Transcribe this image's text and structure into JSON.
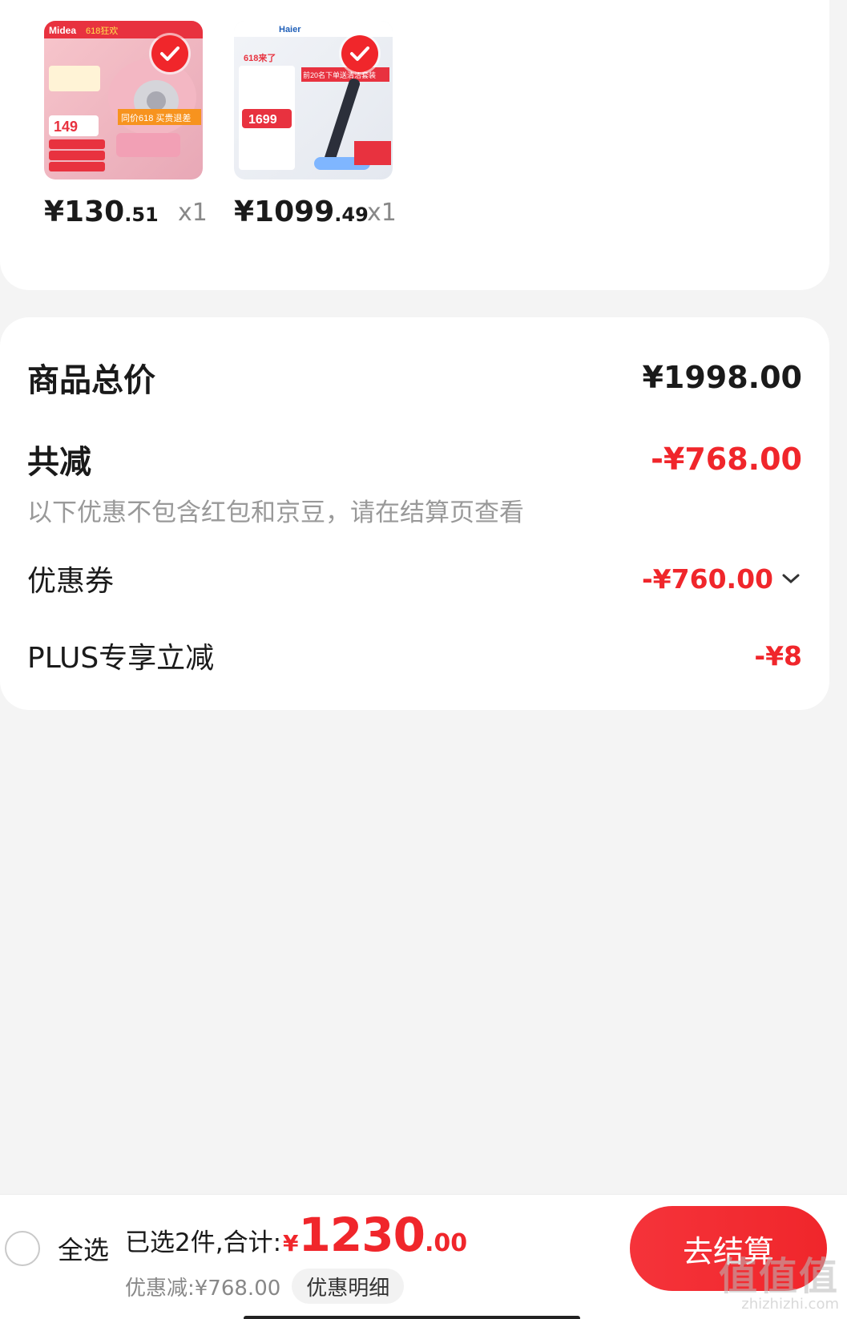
{
  "products": [
    {
      "price_int": "¥130",
      "price_dec": ".51",
      "qty": "x1",
      "brand": "Midea",
      "promo": "618狂欢",
      "badge_price": "149",
      "image_text": "同价618 买贵退差",
      "icon": "check-icon"
    },
    {
      "price_int": "¥1099",
      "price_dec": ".49",
      "qty": "x1",
      "brand": "Haier",
      "promo": "618来了",
      "badge_price": "1699",
      "image_text": "前20名下单送清洁套装",
      "icon": "check-icon"
    }
  ],
  "summary": {
    "total_label": "商品总价",
    "total_value": "¥1998.00",
    "reduce_label": "共减",
    "reduce_value": "-¥768.00",
    "note": "以下优惠不包含红包和京豆，请在结算页查看",
    "coupon_label": "优惠券",
    "coupon_value": "-¥760.00",
    "plus_label": "PLUS专享立减",
    "plus_value": "-¥8"
  },
  "bottom": {
    "select_all": "全选",
    "selected_label": "已选2件,合计:",
    "currency": "¥",
    "sum_int": "1230",
    "sum_dec": ".00",
    "discount_text": "优惠减:¥768.00",
    "detail_button": "优惠明细",
    "checkout_button": "去结算"
  },
  "watermark": {
    "big": "值值值",
    "small": "zhizhizhi.com"
  },
  "colors": {
    "accent": "#f0262b",
    "text": "#1a1a1a",
    "muted": "#999999",
    "background": "#f4f4f4"
  }
}
